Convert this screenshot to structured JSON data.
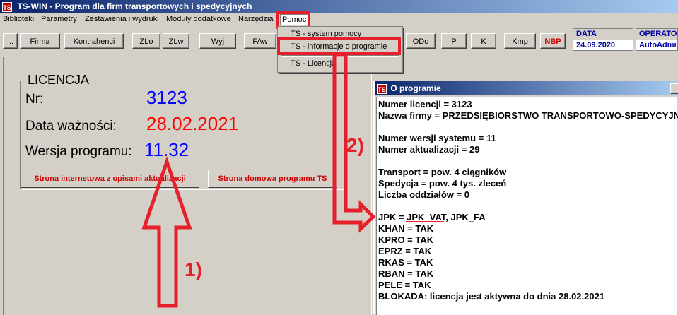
{
  "window": {
    "title": "TS-WIN - Program dla firm transportowych i spedycyjnych",
    "logo": "TS"
  },
  "menu": [
    "Biblioteki",
    "Parametry",
    "Zestawienia i wydruki",
    "Moduły dodatkowe",
    "Narzędzia",
    "Pomoc"
  ],
  "toolbar": {
    "buttons": [
      "...",
      "Firma",
      "Kontrahenci",
      "ZLo",
      "ZLw",
      "Wyj",
      "FAw",
      "ODo",
      "P",
      "K",
      "Kmp",
      "NBP"
    ],
    "data_label": "DATA",
    "data_value": "24.09.2020",
    "operator_label": "OPERATO",
    "operator_value": "AutoAdmin"
  },
  "pomoc_menu": [
    "TS - system pomocy",
    "TS - informacje o programie",
    "TS - Licencja"
  ],
  "licencja": {
    "title": "LICENCJA",
    "nr_label": "Nr:",
    "nr_value": "3123",
    "data_label": "Data ważności:",
    "data_value": "28.02.2021",
    "wersja_label": "Wersja programu:",
    "wersja_value": "11.32",
    "btn_strona_internetowa": "Strona internetowa z opisami aktualizacji",
    "btn_strona_domowa": "Strona domowa programu TS"
  },
  "dialog": {
    "title": "O programie",
    "lines": [
      "Numer licencji = 3123",
      "Nazwa firmy = PRZEDSIĘBIORSTWO TRANSPORTOWO-SPEDYCYJNE/",
      "",
      "Numer wersji systemu = 11",
      "Numer aktualizacji = 29",
      "",
      "Transport = pow. 4 ciągników",
      "Spedycja = pow. 4 tys. zleceń",
      "Liczba oddziałów = 0",
      "",
      "JPK = JPK_VAT, JPK_FA",
      "KHAN = TAK",
      "KPRO = TAK",
      "EPRZ = TAK",
      "RKAS = TAK",
      "RBAN = TAK",
      "PELE = TAK",
      "BLOKADA: licencja jest aktywna do dnia 28.02.2021"
    ]
  },
  "annotations": {
    "step1": "1)",
    "step2": "2)"
  },
  "colors": {
    "accent_red": "#e5202a",
    "value_blue": "#0000ff",
    "value_red": "#ff0000"
  }
}
